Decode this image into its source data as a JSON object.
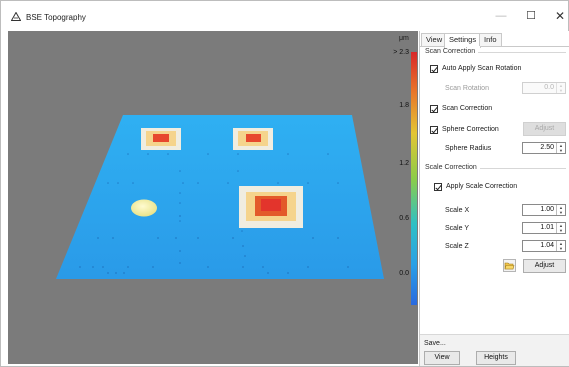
{
  "window": {
    "title": "BSE Topography",
    "icon": "triangle-app-icon",
    "controls": {
      "minimize": "—",
      "maximize": "☐",
      "close": "✕"
    }
  },
  "viewport": {
    "unit": "μm",
    "colorbar_labels": [
      "> 2.3",
      "1.8",
      "1.2",
      "0.6",
      "0.0"
    ]
  },
  "panel": {
    "tabs": [
      {
        "label": "View",
        "active": false
      },
      {
        "label": "Settings",
        "active": true
      },
      {
        "label": "Info",
        "active": false
      }
    ],
    "scan_correction": {
      "title": "Scan Correction",
      "auto_apply_label": "Auto Apply Scan Rotation",
      "auto_apply_checked": true,
      "scan_rotation_label": "Scan Rotation",
      "scan_rotation_value": "0.0",
      "scan_correction_label": "Scan Correction",
      "scan_correction_checked": true,
      "sphere_correction_label": "Sphere Correction",
      "sphere_correction_checked": true,
      "adjust_label": "Adjust",
      "sphere_radius_label": "Sphere Radius",
      "sphere_radius_value": "2.50"
    },
    "scale_correction": {
      "title": "Scale Correction",
      "apply_label": "Apply Scale Correction",
      "apply_checked": true,
      "scale_x_label": "Scale X",
      "scale_x_value": "1.00",
      "scale_y_label": "Scale Y",
      "scale_y_value": "1.01",
      "scale_z_label": "Scale Z",
      "scale_z_value": "1.04",
      "folder_icon": "folder-open-icon",
      "adjust_label": "Adjust"
    },
    "save": {
      "title": "Save...",
      "view_label": "View",
      "heights_label": "Heights"
    }
  }
}
